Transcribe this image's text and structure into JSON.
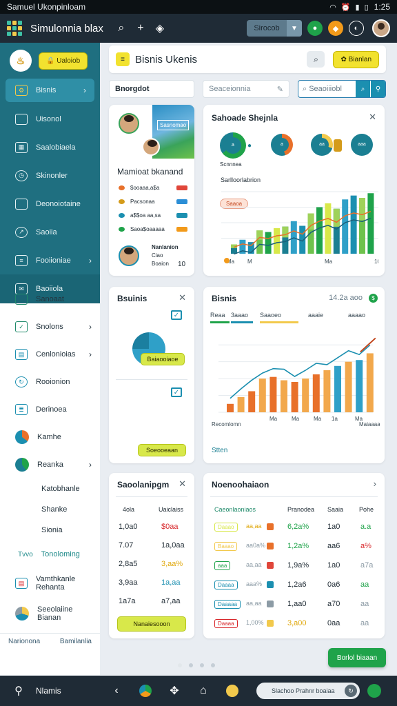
{
  "status": {
    "title": "Samuel Ukonpinloam",
    "time": "1:25"
  },
  "topbar": {
    "app_title": "Simulonnia blax",
    "dropdown": "Sirocob"
  },
  "sidebar": {
    "pill": "Ualoiob",
    "items": [
      {
        "label": "Bisnis"
      },
      {
        "label": "Uisonol"
      },
      {
        "label": "Saalobiaela"
      },
      {
        "label": "Skinonler"
      },
      {
        "label": "Deonoiotaine"
      },
      {
        "label": "Saoiia"
      },
      {
        "label": "Fooiioniae"
      },
      {
        "label": "Baoiiola"
      },
      {
        "label": "Sanoaat"
      },
      {
        "label": "Snolons"
      },
      {
        "label": "Cenlonioias"
      },
      {
        "label": "Rooionion"
      },
      {
        "label": "Derinoea"
      },
      {
        "label": "Kamhe"
      },
      {
        "label": "Reanka"
      },
      {
        "label": "Katobhanle"
      },
      {
        "label": "Shanke"
      },
      {
        "label": "Sionia"
      },
      {
        "label": "Tonoloming",
        "badge": "Tvvo"
      },
      {
        "label": "Vamthkanle Rehanta"
      },
      {
        "label": "Seeolaiine Bianan"
      }
    ],
    "footer_left": "Narionona",
    "footer_right": "Bamilanlia"
  },
  "header": {
    "title": "Bisnis Ukenis",
    "button": "Bianlan"
  },
  "filters": {
    "left": "Bnorgdot",
    "mid": "Seaceionnia",
    "right": "Seaoiiiobl"
  },
  "profile": {
    "banner": "Sasnomao",
    "name": "Mamioat bkanand",
    "rows": [
      {
        "value": "$ooaaa,a$a",
        "color": "#e8702a",
        "badge": "#e0463a"
      },
      {
        "value": "Pacsonaa",
        "color": "#d49b1a",
        "badge": "#2c8ed6"
      },
      {
        "value": "a$$oa aa,sa",
        "color": "#1b8fb0",
        "badge": "#1b8fb0"
      },
      {
        "value": "Saoa$oaaaaa",
        "color": "#1fa34a",
        "badge": "#f29a1a"
      }
    ],
    "person_name": "Nanlanion",
    "person_sub": "Ciao",
    "person_role": "Boaion",
    "person_count": "10"
  },
  "share": {
    "title": "Sahoade Shejnla",
    "sub": "Scnnnea",
    "chart_title": "Sarlloorlabrion",
    "tag": "Saaoa",
    "donuts": [
      {
        "pct": 0.65,
        "color": "#1fa34a",
        "label": "a"
      },
      {
        "pct": 0.45,
        "color": "#e8702a",
        "label": "a"
      },
      {
        "pct": 0.3,
        "color": "#f2c94c",
        "label": "aa"
      },
      {
        "pct": 0.9,
        "color": "#1b7f92",
        "label": "aaa"
      }
    ],
    "xlabels": [
      "Ma",
      "M",
      "Ma",
      "10"
    ]
  },
  "business": {
    "title": "Bsuinis",
    "button": "Baiaooiaoe",
    "bottom": "Soeooeaan"
  },
  "trend": {
    "title": "Bisnis",
    "value": "14.2a aoo",
    "legend": [
      "Reaa",
      "3aaao",
      "Saaoeo",
      "aaaie",
      "aaaao"
    ],
    "footer": "Stten",
    "xlabels": [
      "Recomlomn",
      "Ma",
      "Ma",
      "Ma",
      "1a",
      "Ma",
      "Maiaaaa"
    ]
  },
  "small": {
    "title": "Saoolanipgm",
    "col1": "4ola",
    "col2": "Uaiclaiss",
    "rows": [
      [
        "1,0a0",
        "$0aa",
        "#d8262a"
      ],
      [
        "7.07",
        "1a,0aa",
        "#1e2a33"
      ],
      [
        "2,8a5",
        "3,aa%",
        "#e0a80c"
      ],
      [
        "3,9aa",
        "1a,aa",
        "#1b8fb0"
      ],
      [
        "1a7a",
        "a7,aa",
        "#1e2a33"
      ]
    ],
    "button": "Nanaiesooon"
  },
  "table": {
    "title": "Noenoohaiaon",
    "headers": [
      "Caeonlaoniaos",
      "Pranodea",
      "Saaia",
      "Pohe"
    ],
    "rows": [
      {
        "tag": "Daaao",
        "tagc": "#d8e84a",
        "p": "aa,aa",
        "pc": "#e0a80c",
        "s": "6,2a%",
        "sc": "#1fa34a",
        "n": "1a0",
        "z": "a.a",
        "zc": "#1fa34a",
        "ic": "#e8702a"
      },
      {
        "tag": "Baaao",
        "tagc": "#f2c94c",
        "p": "aa0a%",
        "pc": "#8c9ba5",
        "s": "1,2a%",
        "sc": "#1fa34a",
        "n": "aa6",
        "z": "a%",
        "zc": "#d8262a",
        "ic": "#e8702a"
      },
      {
        "tag": "aaa",
        "tagc": "#1fa34a",
        "p": "aa,aa",
        "pc": "#8c9ba5",
        "s": "1,9a%",
        "sc": "#1e2a33",
        "n": "1a0",
        "z": "a7a",
        "zc": "#8c9ba5",
        "ic": "#e0463a"
      },
      {
        "tag": "Daaaa",
        "tagc": "#1b8fb0",
        "p": "aaa%",
        "pc": "#8c9ba5",
        "s": "1,2a6",
        "sc": "#1e2a33",
        "n": "0a6",
        "z": "aa",
        "zc": "#1fa34a",
        "ic": "#1b8fb0"
      },
      {
        "tag": "Daaaaa",
        "tagc": "#1b8fb0",
        "p": "aa,aa",
        "pc": "#8c9ba5",
        "s": "1,aa0",
        "sc": "#1e2a33",
        "n": "a70",
        "z": "aa",
        "zc": "#8c9ba5",
        "ic": "#8c9ba5"
      },
      {
        "tag": "Daaaa",
        "tagc": "#d8262a",
        "p": "1,00%",
        "pc": "#8c9ba5",
        "s": "3,a00",
        "sc": "#e0a80c",
        "n": "0aa",
        "z": "aa",
        "zc": "#8c9ba5",
        "ic": "#f2c94c"
      }
    ]
  },
  "fab": "Borlol biaaan",
  "navbar": {
    "label": "Nlamis",
    "search": "Slachoo Prahnr boaiaa"
  },
  "chart_data": [
    {
      "type": "bar",
      "series": [
        {
          "name": "",
          "values": [
            12,
            18,
            15,
            30,
            28,
            33,
            35,
            42,
            36,
            52,
            60,
            65,
            58,
            70,
            75,
            72,
            78
          ]
        }
      ]
    },
    {
      "type": "bar",
      "series": [
        {
          "name": "",
          "values": [
            10,
            18,
            25,
            40,
            42,
            38,
            36,
            40,
            45,
            50,
            55,
            60,
            62,
            70
          ]
        }
      ]
    }
  ]
}
